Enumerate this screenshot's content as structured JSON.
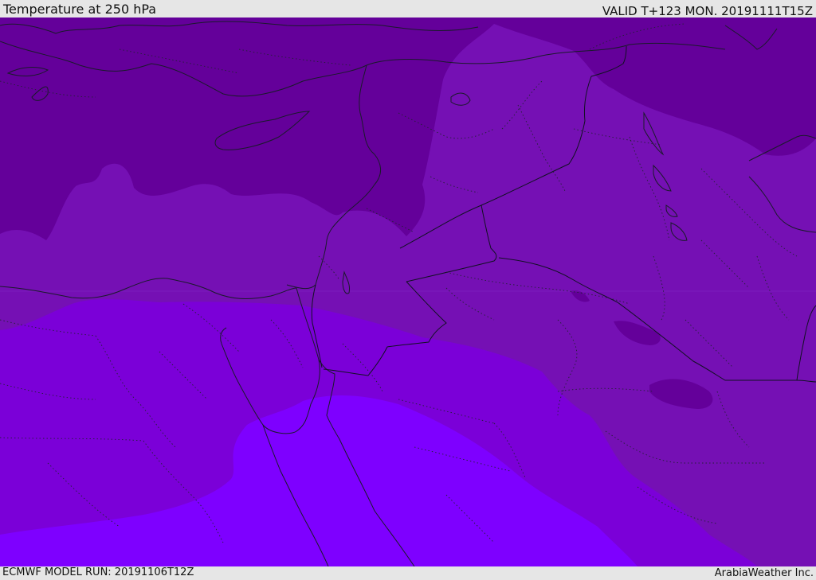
{
  "header": {
    "title": "Temperature at 250 hPa",
    "valid_time": "VALID T+123 MON. 20191111T15Z"
  },
  "footer": {
    "model_run": "ECMWF MODEL RUN: 20191106T12Z",
    "provider": "ArabiaWeather Inc."
  },
  "palette": {
    "band_darkest": "#64009a",
    "band_dark": "#7510b4",
    "band_mid": "#7b00d8",
    "band_light": "#7e00ff",
    "coastline": "#1a1a2a",
    "border": "#111122"
  }
}
